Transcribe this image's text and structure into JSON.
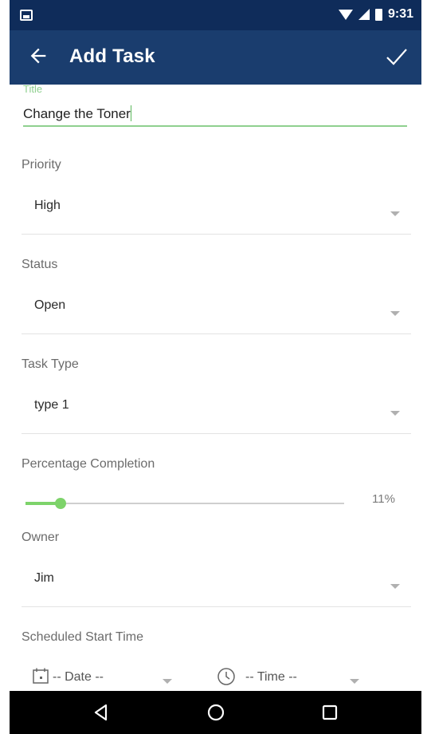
{
  "status_bar": {
    "time": "9:31",
    "icons": [
      "image-icon",
      "wifi-icon",
      "signal-icon",
      "battery-icon"
    ]
  },
  "app_bar": {
    "title": "Add Task",
    "back_icon": "arrow-left-icon",
    "confirm_icon": "check-icon",
    "color": "#1a3d6e"
  },
  "form": {
    "title": {
      "label": "Title",
      "value": "Change the Toner"
    },
    "priority": {
      "label": "Priority",
      "value": "High"
    },
    "status": {
      "label": "Status",
      "value": "Open"
    },
    "task_type": {
      "label": "Task Type",
      "value": "type 1"
    },
    "percentage": {
      "label": "Percentage Completion",
      "value": 0.11,
      "display": "11%"
    },
    "owner": {
      "label": "Owner",
      "value": "Jim"
    },
    "scheduled_start": {
      "label": "Scheduled Start Time",
      "date_placeholder": "-- Date --",
      "time_placeholder": "-- Time --"
    }
  },
  "accent_color": "#7dd36a",
  "nav_bar": {
    "buttons": [
      "back-triangle-icon",
      "home-circle-icon",
      "recents-square-icon"
    ]
  }
}
